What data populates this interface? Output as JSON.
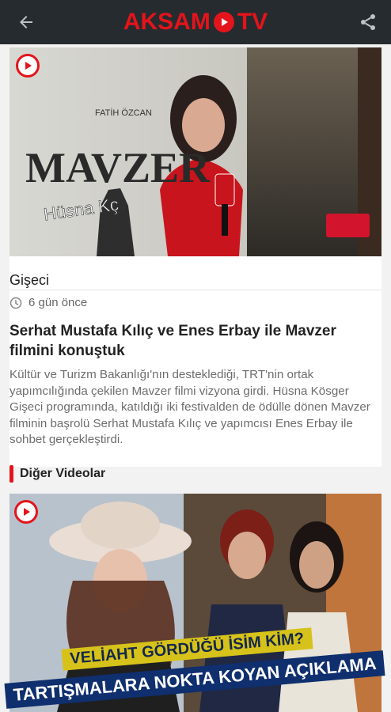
{
  "header": {
    "logo_text_left": "AKSAM",
    "logo_text_right": "TV",
    "back_icon": "arrow-left-icon",
    "share_icon": "share-icon",
    "brand_color": "#e3141b",
    "bar_color": "#262b2f"
  },
  "article": {
    "image_overlay_name": "Hüsna Kç",
    "image_poster_title": "MAVZER",
    "image_poster_credit": "FATİH ÖZCAN",
    "category": "Gişeci",
    "time_ago": "6 gün önce",
    "title": "Serhat Mustafa Kılıç ve Enes Erbay ile Mavzer filmini konuştuk",
    "summary": "Kültür ve Turizm Bakanlığı'nın desteklediği, TRT'nin ortak yapımcılığında çekilen Mavzer filmi vizyona girdi. Hüsna Kösger Gişeci programında, katıldığı iki festivalden de ödülle dönen Mavzer filminin başrolü Serhat Mustafa Kılıç ve yapımcısı Enes Erbay ile sohbet gerçekleştirdi."
  },
  "other_videos": {
    "section_title": "Diğer Videolar",
    "items": [
      {
        "caption_line1": "VELİAHT GÖRDÜĞÜ İSİM KİM?",
        "caption_line2": "TARTIŞMALARA NOKTA KOYAN AÇIKLAMA"
      }
    ]
  }
}
